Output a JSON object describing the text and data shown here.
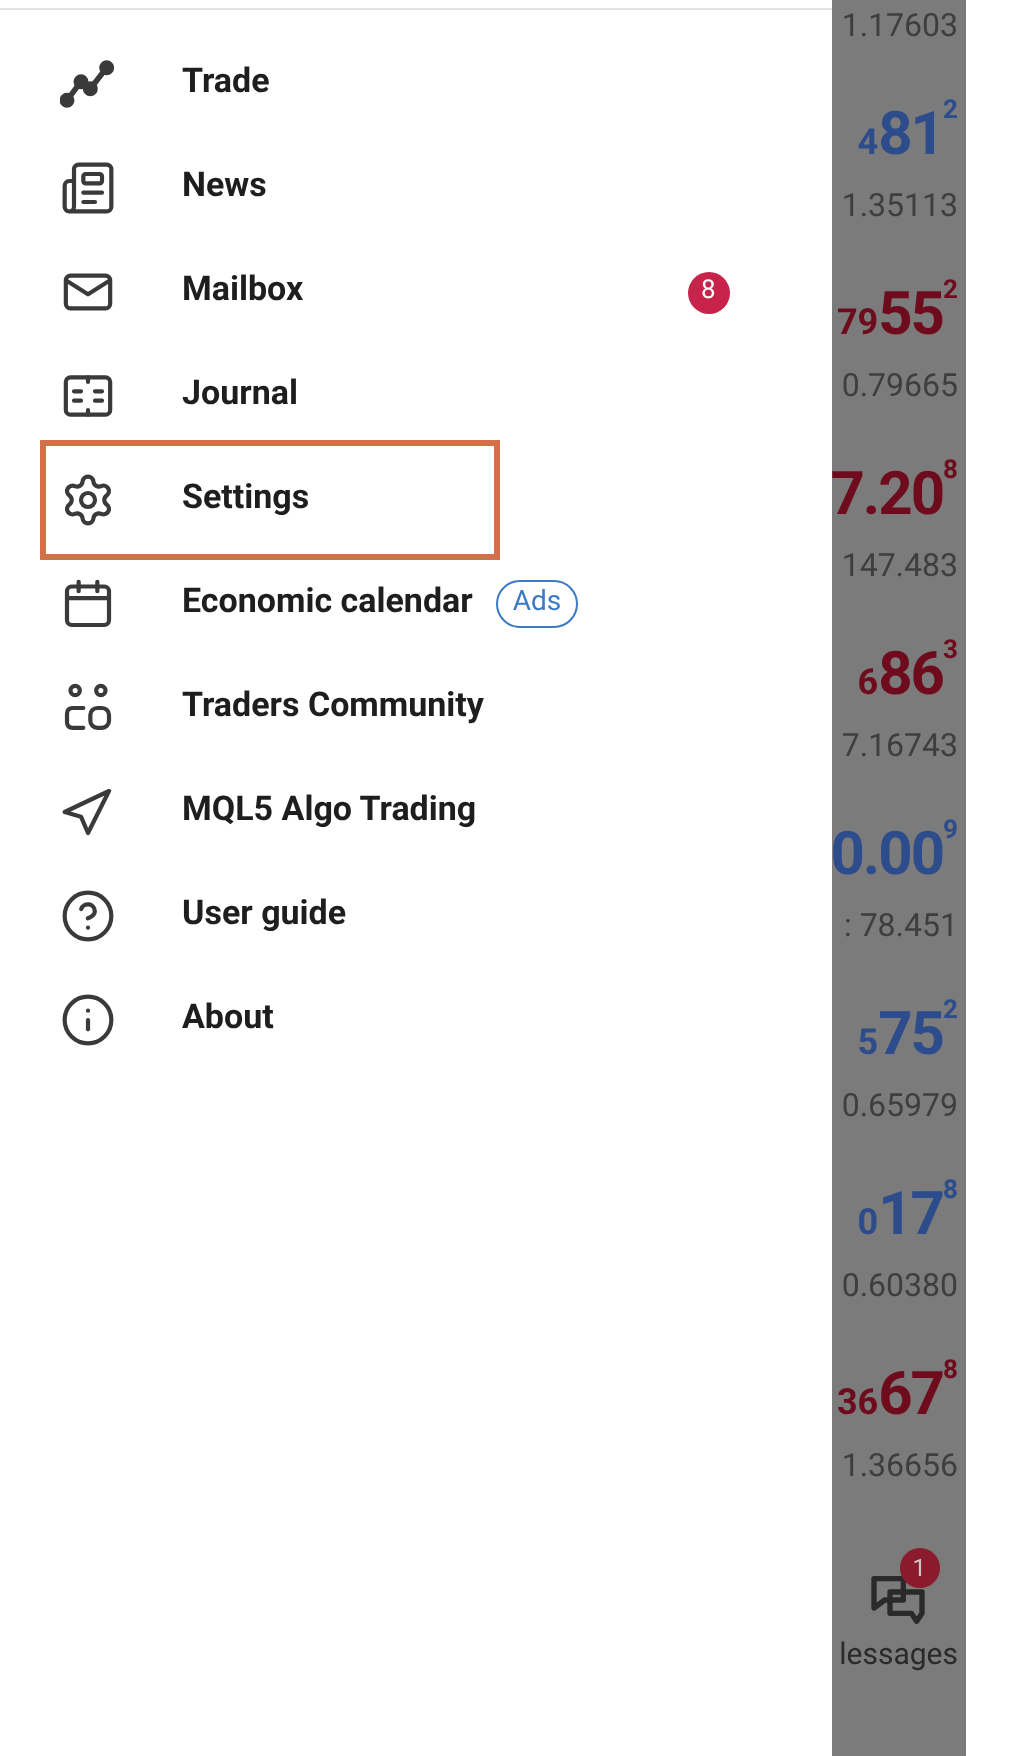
{
  "menu": {
    "items": [
      {
        "label": "Trade",
        "highlighted": false
      },
      {
        "label": "News",
        "highlighted": false
      },
      {
        "label": "Mailbox",
        "highlighted": false,
        "badge": "8"
      },
      {
        "label": "Journal",
        "highlighted": false
      },
      {
        "label": "Settings",
        "highlighted": true
      },
      {
        "label": "Economic calendar",
        "highlighted": false,
        "tag": "Ads"
      },
      {
        "label": "Traders Community",
        "highlighted": false
      },
      {
        "label": "MQL5 Algo Trading",
        "highlighted": false
      },
      {
        "label": "User guide",
        "highlighted": false
      },
      {
        "label": "About",
        "highlighted": false
      }
    ]
  },
  "quotes": {
    "top_price": "1.17603",
    "rows": [
      {
        "prefix": "4",
        "big": "81",
        "sup": "2",
        "color": "#2c4c8c",
        "price": "1.35113"
      },
      {
        "prefix": "79",
        "big": "55",
        "sup": "2",
        "color": "#6e0b1c",
        "price": "0.79665"
      },
      {
        "prefix": "",
        "big": "7.20",
        "sup": "8",
        "color": "#6e0b1c",
        "price": "147.483"
      },
      {
        "prefix": "6",
        "big": "86",
        "sup": "3",
        "color": "#6e0b1c",
        "price": "7.16743"
      },
      {
        "prefix": "",
        "big": "0.00",
        "sup": "9",
        "color": "#2c4c8c",
        "price": ": 78.451"
      },
      {
        "prefix": "5",
        "big": "75",
        "sup": "2",
        "color": "#2c4c8c",
        "price": "0.65979"
      },
      {
        "prefix": "0",
        "big": "17",
        "sup": "8",
        "color": "#2c4c8c",
        "price": "0.60380"
      },
      {
        "prefix": "36",
        "big": "67",
        "sup": "8",
        "color": "#6e0b1c",
        "price": "1.36656"
      }
    ]
  },
  "bottom_tab": {
    "label": "lessages",
    "badge": "1"
  }
}
